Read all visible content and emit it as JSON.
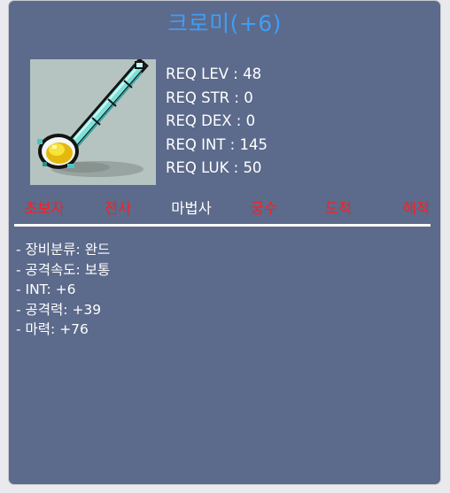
{
  "item": {
    "name": "크로미(+6)",
    "icon": "wand-icon",
    "title_color": "#3f9df7"
  },
  "requirements": [
    "REQ LEV : 48",
    "REQ STR : 0",
    "REQ DEX : 0",
    "REQ INT : 145",
    "REQ LUK : 50"
  ],
  "jobs": [
    {
      "label": "초보자",
      "active": false
    },
    {
      "label": "전사",
      "active": false
    },
    {
      "label": "마법사",
      "active": true
    },
    {
      "label": "궁수",
      "active": false
    },
    {
      "label": "도적",
      "active": false
    },
    {
      "label": "해적",
      "active": false
    }
  ],
  "job_colors": {
    "unavailable": "#ff1d1d",
    "available": "#ffffff"
  },
  "stats": [
    "- 장비분류: 완드",
    "- 공격속도: 보통",
    "- INT: +6",
    "- 공격력: +39",
    "- 마력: +76"
  ],
  "panel_color": "#5c6a8b"
}
